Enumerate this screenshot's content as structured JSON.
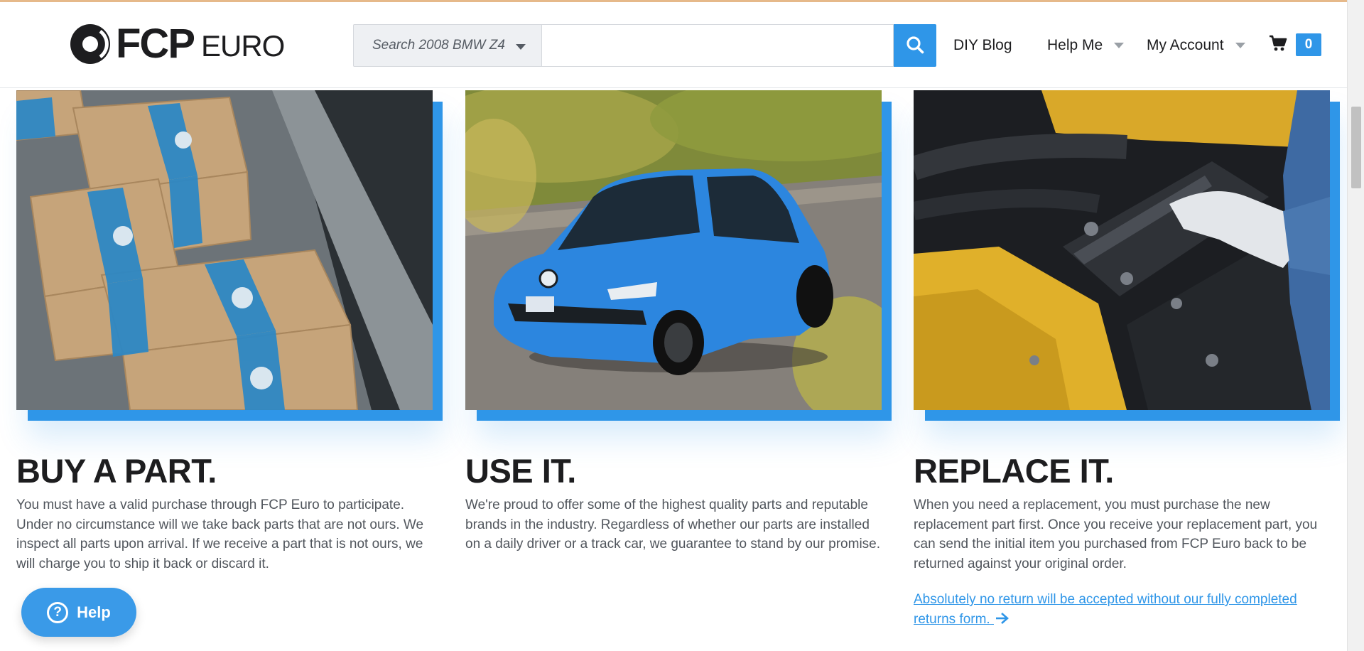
{
  "header": {
    "logo": {
      "text_fcp": "FCP",
      "text_euro": "EURO"
    },
    "search": {
      "vehicle_label": "Search 2008 BMW Z4",
      "input_value": "",
      "input_placeholder": ""
    },
    "nav": {
      "blog": "DIY Blog",
      "help": "Help Me",
      "account": "My Account"
    },
    "cart": {
      "count": "0"
    }
  },
  "cards": [
    {
      "title": "BUY A PART.",
      "text": "You must have a valid purchase through FCP Euro to participate. Under no circumstance will we take back parts that are not ours. We inspect all parts upon arrival. If we receive a part that is not ours, we will charge you to ship it back or discard it."
    },
    {
      "title": "USE IT.",
      "text": "We're proud to offer some of the highest quality parts and reputable brands in the industry. Regardless of whether our parts are installed on a daily driver or a track car, we guarantee to stand by our promise."
    },
    {
      "title": "REPLACE IT.",
      "text": "When you need a replacement, you must purchase the new replacement part first. Once you receive your replacement part, you can send the initial item you purchased from FCP Euro back to be returned against your original order.",
      "link": "Absolutely no return will be accepted without our fully completed returns form."
    }
  ],
  "help_button": {
    "label": "Help",
    "icon": "?"
  },
  "colors": {
    "accent": "#2f96e8",
    "text": "#1d1d1f",
    "body_text": "#50555c"
  }
}
